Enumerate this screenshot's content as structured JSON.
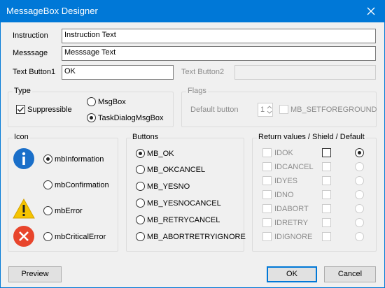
{
  "window": {
    "title": "MessageBox Designer"
  },
  "fields": {
    "instruction_label": "Instruction",
    "instruction_value": "Instruction Text",
    "message_label": "Messsage",
    "message_value": "Messsage Text",
    "button1_label": "Text Button1",
    "button1_value": "OK",
    "button2_label": "Text Button2",
    "button2_value": ""
  },
  "type_group": {
    "title": "Type",
    "suppressible": {
      "label": "Suppressible",
      "checked": true
    },
    "msgbox": {
      "label": "MsgBox",
      "checked": false
    },
    "taskdialog": {
      "label": "TaskDialogMsgBox",
      "checked": true
    }
  },
  "flags_group": {
    "title": "Flags",
    "default_button_label": "Default button",
    "default_button_value": "1",
    "setforeground_label": "MB_SETFOREGROUND"
  },
  "icon_group": {
    "title": "Icon",
    "options": [
      {
        "label": "mbInformation",
        "checked": true,
        "icon": "information-icon"
      },
      {
        "label": "mbConfirmation",
        "checked": false,
        "icon": ""
      },
      {
        "label": "mbError",
        "checked": false,
        "icon": "warning-icon"
      },
      {
        "label": "mbCriticalError",
        "checked": false,
        "icon": "error-icon"
      }
    ]
  },
  "buttons_group": {
    "title": "Buttons",
    "options": [
      {
        "label": "MB_OK",
        "checked": true
      },
      {
        "label": "MB_OKCANCEL",
        "checked": false
      },
      {
        "label": "MB_YESNO",
        "checked": false
      },
      {
        "label": "MB_YESNOCANCEL",
        "checked": false
      },
      {
        "label": "MB_RETRYCANCEL",
        "checked": false
      },
      {
        "label": "MB_ABORTRETRYIGNORE",
        "checked": false
      }
    ]
  },
  "return_group": {
    "title": "Return values / Shield  / Default",
    "rows": [
      {
        "label": "IDOK",
        "shield_enabled": true,
        "default_checked": true,
        "enabled": true
      },
      {
        "label": "IDCANCEL",
        "shield_enabled": false,
        "default_checked": false,
        "enabled": false
      },
      {
        "label": "IDYES",
        "shield_enabled": false,
        "default_checked": false,
        "enabled": false
      },
      {
        "label": "IDNO",
        "shield_enabled": false,
        "default_checked": false,
        "enabled": false
      },
      {
        "label": "IDABORT",
        "shield_enabled": false,
        "default_checked": false,
        "enabled": false
      },
      {
        "label": "IDRETRY",
        "shield_enabled": false,
        "default_checked": false,
        "enabled": false
      },
      {
        "label": "IDIGNORE",
        "shield_enabled": false,
        "default_checked": false,
        "enabled": false
      }
    ]
  },
  "footer": {
    "preview_label": "Preview",
    "ok_label": "OK",
    "cancel_label": "Cancel"
  },
  "colors": {
    "titlebar": "#0078d7",
    "info_icon": "#1a6fc9",
    "warning_icon": "#f5c400",
    "error_icon": "#e8452c"
  }
}
